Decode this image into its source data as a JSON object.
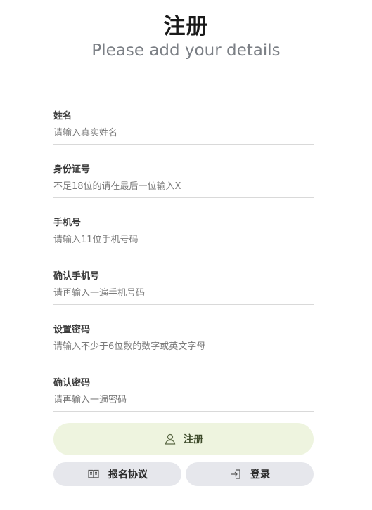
{
  "header": {
    "title": "注册",
    "subtitle": "Please add your details"
  },
  "form": {
    "fields": [
      {
        "label": "姓名",
        "placeholder": "请输入真实姓名"
      },
      {
        "label": "身份证号",
        "placeholder": "不足18位的请在最后一位输入X"
      },
      {
        "label": "手机号",
        "placeholder": "请输入11位手机号码"
      },
      {
        "label": "确认手机号",
        "placeholder": "请再输入一遍手机号码"
      },
      {
        "label": "设置密码",
        "placeholder": "请输入不少于6位数的数字或英文字母"
      },
      {
        "label": "确认密码",
        "placeholder": "请再输入一遍密码"
      }
    ]
  },
  "actions": {
    "register_label": "注册",
    "register_icon": "user-icon",
    "agreement_label": "报名协议",
    "agreement_icon": "book-icon",
    "login_label": "登录",
    "login_icon": "login-icon"
  },
  "colors": {
    "register_bg": "#eef4df",
    "secondary_bg": "#e6e7ec"
  }
}
